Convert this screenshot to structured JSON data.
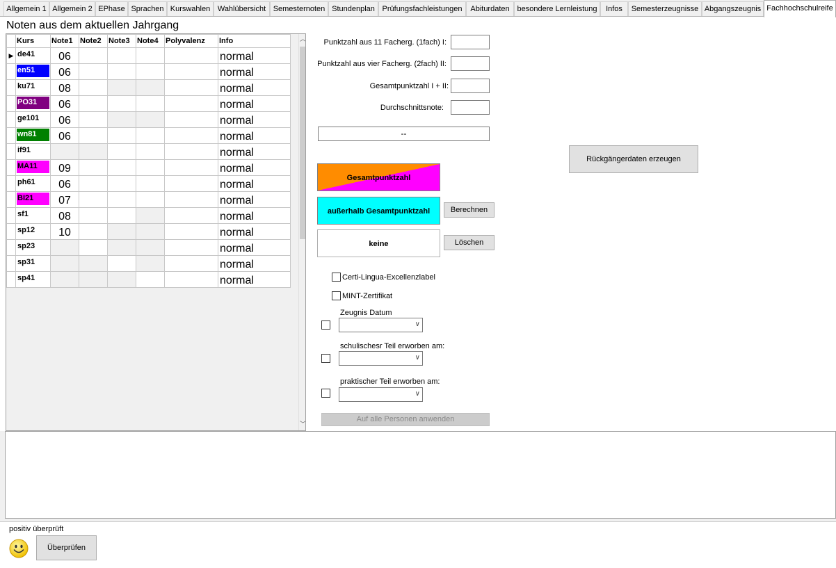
{
  "tabs": [
    {
      "label": "Allgemein 1"
    },
    {
      "label": "Allgemein 2"
    },
    {
      "label": "EPhase"
    },
    {
      "label": "Sprachen"
    },
    {
      "label": "Kurswahlen"
    },
    {
      "label": "Wahlübersicht"
    },
    {
      "label": "Semesternoten"
    },
    {
      "label": "Stundenplan"
    },
    {
      "label": "Prüfungsfachleistungen"
    },
    {
      "label": "Abiturdaten"
    },
    {
      "label": "besondere Lernleistung"
    },
    {
      "label": "Infos"
    },
    {
      "label": "Semesterzeugnisse"
    },
    {
      "label": "Abgangszeugnis"
    },
    {
      "label": "Fachhochschulreife"
    }
  ],
  "section_title": "Noten aus dem aktuellen Jahrgang",
  "grid": {
    "columns": [
      "Kurs",
      "Note1",
      "Note2",
      "Note3",
      "Note4",
      "Polyvalenz",
      "Info"
    ],
    "rows": [
      {
        "kurs": "de41",
        "color": "",
        "text_color": "#000000",
        "note1": "06",
        "info": "normal",
        "dis": [
          false,
          false,
          false,
          false
        ]
      },
      {
        "kurs": "en51",
        "color": "#0000ff",
        "text_color": "#ffffff",
        "note1": "06",
        "info": "normal",
        "dis": [
          false,
          false,
          false,
          false
        ]
      },
      {
        "kurs": "ku71",
        "color": "",
        "text_color": "#000000",
        "note1": "08",
        "info": "normal",
        "dis": [
          false,
          false,
          true,
          true
        ]
      },
      {
        "kurs": "PO31",
        "color": "#800080",
        "text_color": "#ffffff",
        "note1": "06",
        "info": "normal",
        "dis": [
          false,
          false,
          false,
          false
        ]
      },
      {
        "kurs": "ge101",
        "color": "",
        "text_color": "#000000",
        "note1": "06",
        "info": "normal",
        "dis": [
          false,
          false,
          true,
          true
        ]
      },
      {
        "kurs": "wn81",
        "color": "#008000",
        "text_color": "#ffffff",
        "note1": "06",
        "info": "normal",
        "dis": [
          false,
          false,
          false,
          false
        ]
      },
      {
        "kurs": "if91",
        "color": "",
        "text_color": "#000000",
        "note1": "",
        "info": "normal",
        "dis": [
          true,
          true,
          false,
          false
        ]
      },
      {
        "kurs": "MA11",
        "color": "#ff00ff",
        "text_color": "#000000",
        "note1": "09",
        "info": "normal",
        "dis": [
          false,
          false,
          false,
          false
        ]
      },
      {
        "kurs": "ph61",
        "color": "",
        "text_color": "#000000",
        "note1": "06",
        "info": "normal",
        "dis": [
          false,
          false,
          false,
          false
        ]
      },
      {
        "kurs": "BI21",
        "color": "#ff00ff",
        "text_color": "#000000",
        "note1": "07",
        "info": "normal",
        "dis": [
          false,
          false,
          false,
          false
        ]
      },
      {
        "kurs": "sf1",
        "color": "",
        "text_color": "#000000",
        "note1": "08",
        "info": "normal",
        "dis": [
          false,
          false,
          false,
          true
        ]
      },
      {
        "kurs": "sp12",
        "color": "",
        "text_color": "#000000",
        "note1": "10",
        "info": "normal",
        "dis": [
          false,
          false,
          true,
          true
        ]
      },
      {
        "kurs": "sp23",
        "color": "",
        "text_color": "#000000",
        "note1": "",
        "info": "normal",
        "dis": [
          true,
          false,
          true,
          true
        ]
      },
      {
        "kurs": "sp31",
        "color": "",
        "text_color": "#000000",
        "note1": "",
        "info": "normal",
        "dis": [
          true,
          true,
          false,
          true
        ]
      },
      {
        "kurs": "sp41",
        "color": "",
        "text_color": "#000000",
        "note1": "",
        "info": "normal",
        "dis": [
          true,
          true,
          true,
          false
        ]
      }
    ]
  },
  "form": {
    "punktzahl_1_label": "Punktzahl aus 11 Facherg. (1fach) I:",
    "punktzahl_2_label": "Punktzahl aus vier Facherg. (2fach) II:",
    "gesamt_label": "Gesamtpunktzahl I + II:",
    "durchschnitt_label": "Durchschnittsnote:",
    "status_value": "--",
    "rueckgaenger_button": "Rückgängerdaten erzeugen",
    "gesamtpunktzahl_button": "Gesamtpunktzahl",
    "ausserhalb_button": "außerhalb Gesamtpunktzahl",
    "keine_button": "keine",
    "berechnen_button": "Berechnen",
    "loeschen_button": "Löschen",
    "certi_label": "Certi-Lingua-Excellenzlabel",
    "mint_label": "MINT-Zertifikat",
    "zeugnis_datum_label": "Zeugnis Datum",
    "schulisch_label": "schulischesr Teil erworben am:",
    "praktisch_label": "praktischer Teil erworben am:",
    "apply_all_button": "Auf alle Personen anwenden"
  },
  "colors": {
    "gesamt_orange": "#ff8c00",
    "gesamt_magenta": "#ff00ff",
    "ausserhalb_cyan": "#00ffff"
  },
  "footer": {
    "status_text": "positiv überprüft",
    "check_button": "Überprüfen"
  }
}
